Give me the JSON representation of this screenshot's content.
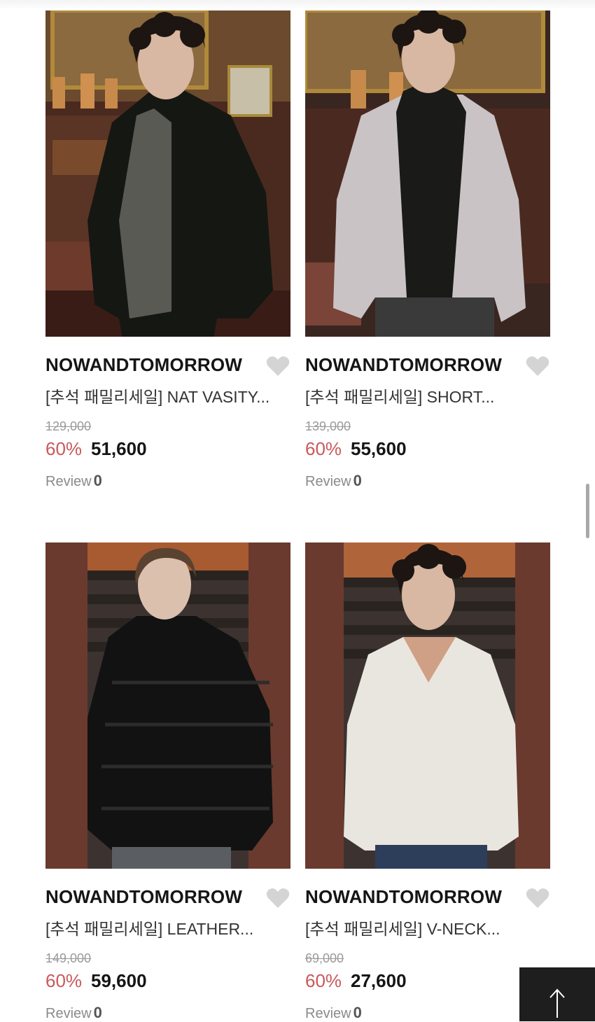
{
  "products": [
    {
      "brand": "NOWANDTOMORROW",
      "title": "[추석 패밀리세일] NAT VASITY...",
      "original_price": "129,000",
      "discount": "60%",
      "sale_price": "51,600",
      "review_label": "Review",
      "review_count": "0",
      "image_semantic": "model-black-varsity-jacket-photo"
    },
    {
      "brand": "NOWANDTOMORROW",
      "title": "[추석 패밀리세일] SHORT...",
      "original_price": "139,000",
      "discount": "60%",
      "sale_price": "55,600",
      "review_label": "Review",
      "review_count": "0",
      "image_semantic": "model-grey-short-jacket-photo"
    },
    {
      "brand": "NOWANDTOMORROW",
      "title": "[추석 패밀리세일] LEATHER...",
      "original_price": "149,000",
      "discount": "60%",
      "sale_price": "59,600",
      "review_label": "Review",
      "review_count": "0",
      "image_semantic": "model-black-leather-puffer-photo"
    },
    {
      "brand": "NOWANDTOMORROW",
      "title": "[추석 패밀리세일] V-NECK...",
      "original_price": "69,000",
      "discount": "60%",
      "sale_price": "27,600",
      "review_label": "Review",
      "review_count": "0",
      "image_semantic": "model-white-vneck-cardigan-photo"
    }
  ],
  "icons": {
    "wishlist": "heart-icon",
    "scroll_top": "arrow-up-icon"
  },
  "colors": {
    "discount": "#c9595b",
    "heart": "#d4d4d4",
    "top_button": "#1e1e1e"
  }
}
